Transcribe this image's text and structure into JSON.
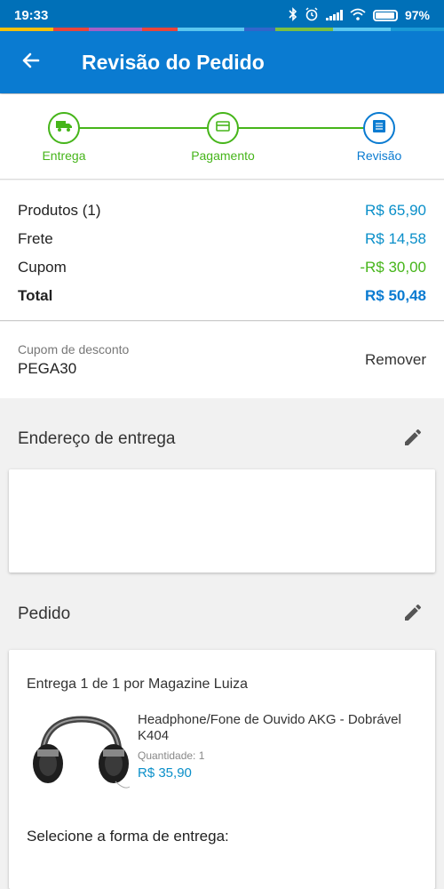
{
  "status_bar": {
    "time": "19:33",
    "battery": "97%",
    "icons": [
      "bluetooth-icon",
      "alarm-icon",
      "signal-icon",
      "wifi-icon",
      "battery-icon"
    ]
  },
  "app_bar": {
    "title": "Revisão do Pedido",
    "back_icon": "arrow-left-icon",
    "color": "#0a7bd1"
  },
  "stepper": {
    "steps": [
      {
        "label": "Entrega",
        "icon": "truck-icon",
        "state": "done"
      },
      {
        "label": "Pagamento",
        "icon": "credit-card-icon",
        "state": "done"
      },
      {
        "label": "Revisão",
        "icon": "list-icon",
        "state": "active"
      }
    ],
    "done_color": "#46b51a",
    "active_color": "#0a7bd1"
  },
  "summary": {
    "products_label": "Produtos (1)",
    "products_value": "R$ 65,90",
    "shipping_label": "Frete",
    "shipping_value": "R$ 14,58",
    "coupon_label": "Cupom",
    "coupon_value": "-R$ 30,00",
    "total_label": "Total",
    "total_value": "R$ 50,48"
  },
  "coupon": {
    "caption": "Cupom de desconto",
    "code": "PEGA30",
    "remove_label": "Remover"
  },
  "address_section": {
    "title": "Endereço de entrega",
    "edit_icon": "pencil-icon"
  },
  "order_section": {
    "title": "Pedido",
    "edit_icon": "pencil-icon",
    "delivery_title": "Entrega 1 de 1 por Magazine Luiza",
    "product": {
      "name": "Headphone/Fone de Ouvido AKG - Dobrável K404",
      "quantity_label": "Quantidade:",
      "quantity_value": "1",
      "price": "R$ 35,90"
    },
    "shipping_prompt": "Selecione a forma de entrega:"
  }
}
